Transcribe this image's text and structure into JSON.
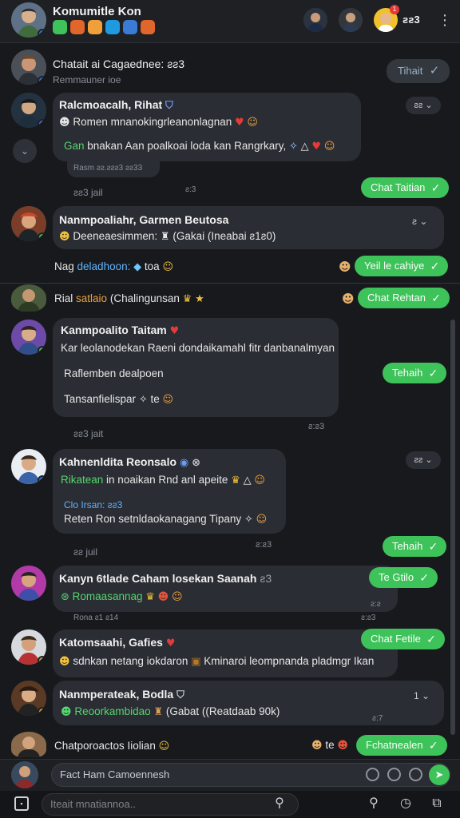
{
  "header": {
    "title": "Komumitle Kon",
    "count": "ƨƨ3",
    "notif": "1",
    "icon_colors": [
      "#3ec25a",
      "#e0662c",
      "#f0a03a",
      "#1e9be0",
      "#3a7bd5",
      "#e0662c"
    ]
  },
  "messages": [
    {
      "name": "Chatait ai Cagaednee: ƨƨ3",
      "sub": "Remmauner ioe",
      "reply": "Tihait"
    },
    {
      "name": "Ralcmoacalh, Rihat",
      "line1": "Romen mnanokingrleanonlagnan",
      "line2_green": "Gan",
      "line2": " bnakan Aan poalkoai loda kan Rangrkary,",
      "stamp": "Rasm ƨƨ.ƨƨƨ3  ƨƨ33",
      "time": "ƨƨ3  jail",
      "time2": "ƨ:3",
      "reply": "Chat Taitian"
    },
    {
      "name": "Nanmpoaliahr, Garmen Beutosa",
      "line1": "Deeneaesimmen:",
      "line1b": "(Gakai (Ineabai ƨ1ƨ0)",
      "under_blue": "deladhoon:",
      "under_prefix": "Nag",
      "under_suffix": "toa",
      "reply": "Yeil le cahiye"
    },
    {
      "name": "Rial",
      "name_orange": "satlaio",
      "name_tail": "(Chalingunsan",
      "reply": "Chat Rehtan"
    },
    {
      "name": "Kanmpoalito Taitam",
      "line1": "Kar leolanodekan Raeni dondaikamahl fitr danbanalmyan",
      "line2": "Raflemben dealpoen",
      "line3": "Tansanfielispar",
      "line3b": "te",
      "time": "ƨƨ3  jait",
      "time2": "ƨ:ƨ3",
      "reply": "Tehaih"
    },
    {
      "name": "Kahnenldita Reonsalo",
      "line1_green": "Rikatean",
      "line1": " in noaikan Rnd anl apeite",
      "line2_blue": "Clo Irsan: ƨƨ3",
      "line3": "Reten Ron setnldaokanagang Tipany",
      "time": "ƨƨ  juil",
      "time2": "ƨ:ƨ3",
      "reply": "Tehaih"
    },
    {
      "name": "Kanyn 6tlade Caham losekan Saanah",
      "name_tail": "ƨ3",
      "line1_green": "Romaasannag",
      "stamp": "Rona ƨ1 ƨ14",
      "stamp2": "ƨ:ƨ3",
      "stamp3": "ƨ:ƨ",
      "reply": "Te Gtilo"
    },
    {
      "name": "Katomsaahi, Gafies",
      "line1": "sdnkan netang iokdaron",
      "line1b": "Kminaroi leompnanda pladmgr Ikan",
      "reply": "Chat Fetile"
    },
    {
      "name": "Nanmperateak, Bodla",
      "line1_green": "Reoorkambidao",
      "line1": "(Gabat ((Reatdaab 90k)",
      "time2": "ƨ:7",
      "reply": ""
    },
    {
      "name": "Chatporoactos Iiolian",
      "suffix": "te",
      "reply": "Fchatnealen"
    }
  ],
  "composer": {
    "placeholder": "Fact Ham Camoennesh"
  },
  "bottombar": {
    "search_placeholder": "Iteait mnatiannoa.."
  },
  "controls": {
    "mini": "ƨƨ"
  }
}
